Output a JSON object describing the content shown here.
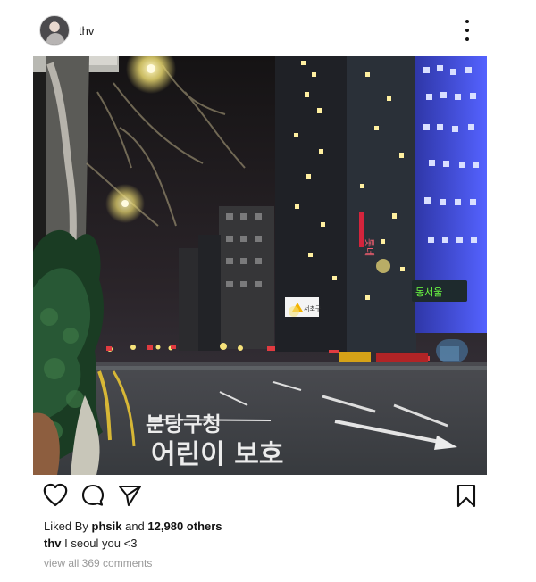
{
  "post": {
    "username": "thv",
    "image_alt": "Night street view with tall lit buildings and road markings",
    "liked_by_prefix": "Liked By",
    "liked_by_user": "phsik",
    "liked_by_connector": "and",
    "likes_count_text": "12,980 others",
    "caption_username": "thv",
    "caption_text": "I seoul you <3",
    "view_comments_text": "view all 369 comments"
  },
  "icons": {
    "profile": "avatar",
    "menu": "more-vertical-icon",
    "like": "heart-icon",
    "comment": "comment-icon",
    "share": "send-icon",
    "save": "bookmark-icon"
  },
  "photo": {
    "road_text_1": "분당구청",
    "road_text_2": "어린이 보호",
    "sign_text": "서초구",
    "building_sign": "롯데",
    "traffic_text": "동서울"
  },
  "colors": {
    "text": "#111111",
    "muted": "#9a9a9a",
    "background": "#ffffff"
  }
}
